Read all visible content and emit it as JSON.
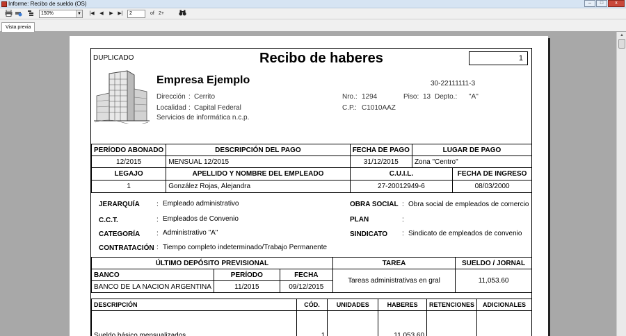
{
  "window": {
    "title": "Informe: Recibo de sueldo (OS)",
    "controls": [
      "–",
      "□",
      "x"
    ]
  },
  "toolbar": {
    "print_icon": "printer-icon",
    "zoom_value": "150%",
    "page_current": "2",
    "page_of_label": "of",
    "page_total": "2+",
    "nav_first": "first-page-icon",
    "nav_prev": "prev-page-icon",
    "nav_next": "next-page-icon",
    "nav_last": "last-page-icon",
    "find_icon": "binoculars-icon"
  },
  "tab": {
    "label": "Vista previa"
  },
  "receipt": {
    "copy_label": "DUPLICADO",
    "title": "Recibo de haberes",
    "number": "1",
    "company": {
      "name": "Empresa Ejemplo",
      "cuit": "30-22111111-3",
      "direccion_label": "Dirección",
      "direccion": "Cerrito",
      "localidad_label": "Localidad",
      "localidad": "Capital Federal",
      "actividad": "Servicios de informática n.c.p.",
      "nro_label": "Nro.:",
      "nro": "1294",
      "piso_label": "Piso:",
      "piso": "13",
      "depto_label": "Depto.:",
      "depto": "\"A\"",
      "cp_label": "C.P.:",
      "cp": "C1010AAZ"
    },
    "pago": {
      "headers": [
        "PERÍODO ABONADO",
        "DESCRIPCIÓN DEL PAGO",
        "FECHA DE PAGO",
        "LUGAR DE PAGO"
      ],
      "values": [
        "12/2015",
        "MENSUAL 12/2015",
        "31/12/2015",
        "Zona \"Centro\""
      ]
    },
    "empleado": {
      "headers": [
        "LEGAJO",
        "APELLIDO Y NOMBRE DEL EMPLEADO",
        "C.U.I.L.",
        "FECHA DE INGRESO"
      ],
      "values": [
        "1",
        "González Rojas, Alejandra",
        "27-20012949-6",
        "08/03/2000"
      ]
    },
    "details_left": [
      {
        "label": "JERARQUÍA",
        "value": "Empleado administrativo"
      },
      {
        "label": "C.C.T.",
        "value": "Empleados de Convenio"
      },
      {
        "label": "CATEGORÍA",
        "value": "Administrativo \"A\""
      },
      {
        "label": "CONTRATACIÓN",
        "value": "Tiempo completo indeterminado/Trabajo Permanente"
      }
    ],
    "details_right": [
      {
        "label": "OBRA SOCIAL",
        "value": "Obra social de empleados de comercio"
      },
      {
        "label": "PLAN",
        "value": ""
      },
      {
        "label": "SINDICATO",
        "value": "Sindicato de empleados de convenio"
      }
    ],
    "deposito": {
      "title": "ÚLTIMO DEPÓSITO PREVISIONAL",
      "banco_label": "BANCO",
      "periodo_label": "PERÍODO",
      "fecha_label": "FECHA",
      "banco": "BANCO DE LA NACION ARGENTINA",
      "periodo": "11/2015",
      "fecha": "09/12/2015",
      "tarea_label": "TAREA",
      "tarea": "Tareas administrativas en gral",
      "sueldo_label": "SUELDO / JORNAL",
      "sueldo": "11,053.60"
    },
    "conceptos": {
      "headers": [
        "DESCRIPCIÓN",
        "CÓD.",
        "UNIDADES",
        "HABERES",
        "RETENCIONES",
        "ADICIONALES"
      ],
      "rows": [
        {
          "descripcion": "Sueldo básico mensualizados",
          "codigo": "1",
          "unidades": "",
          "haberes": "11,053.60",
          "retenciones": "",
          "adicionales": ""
        }
      ]
    }
  }
}
